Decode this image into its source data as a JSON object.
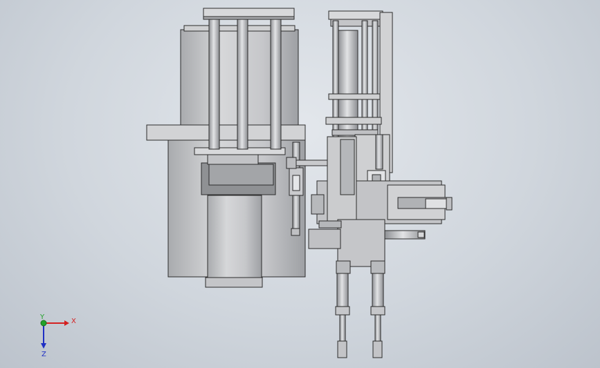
{
  "viewport": {
    "background_top": "#e3e7ec",
    "background_bottom": "#bcc3cc"
  },
  "model": {
    "body_color": "#c9cacd",
    "shadow_color": "#9c9ea2",
    "outline_color": "#2b2b2b",
    "dark_block_color": "#8f9194",
    "frame_color": "#d8d9db"
  },
  "triad": {
    "x_label": "X",
    "y_label": "Y",
    "z_label": "Z",
    "x_color": "#d42020",
    "y_color": "#22a22a",
    "z_color": "#1f2fc4"
  }
}
